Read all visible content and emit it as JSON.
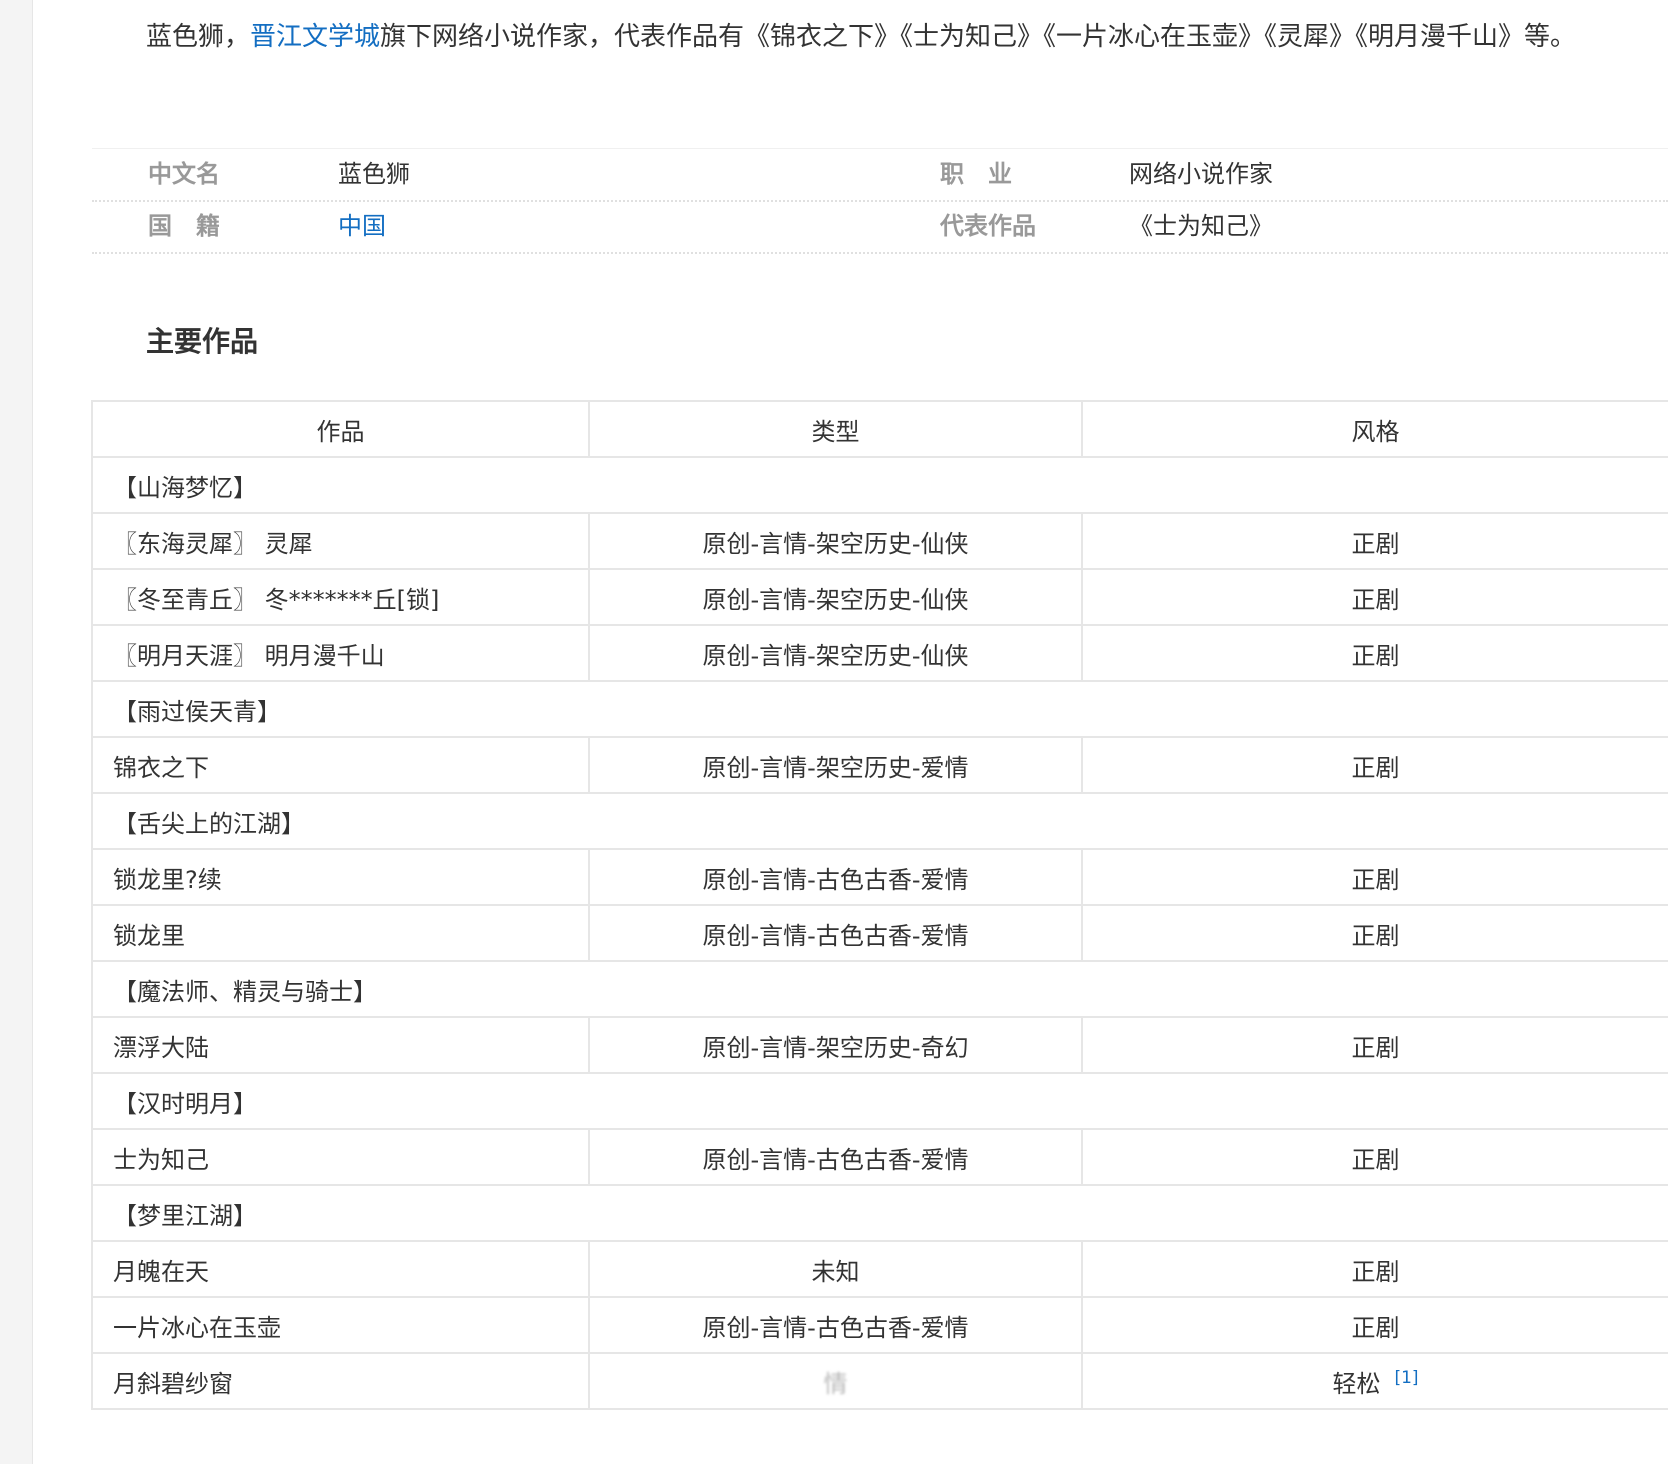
{
  "intro": {
    "prefix": "蓝色狮，",
    "link": "晋江文学城",
    "suffix": "旗下网络小说作家，代表作品有《锦衣之下》《士为知己》《一片冰心在玉壶》《灵犀》《明月漫千山》等。"
  },
  "basic_info": {
    "name_label": "中文名",
    "name_value": "蓝色狮",
    "job_label": "职业",
    "job_value": "网络小说作家",
    "country_label": "国籍",
    "country_value": "中国",
    "works_label": "代表作品",
    "works_value": "《士为知己》"
  },
  "section_title": "主要作品",
  "table": {
    "headers": [
      "作品",
      "类型",
      "风格"
    ],
    "rows": [
      {
        "group": "【山海梦忆】"
      },
      {
        "name": "〖东海灵犀〗 灵犀",
        "type": "原创-言情-架空历史-仙侠",
        "style": "正剧"
      },
      {
        "name": "〖冬至青丘〗 冬*******丘[锁]",
        "type": "原创-言情-架空历史-仙侠",
        "style": "正剧"
      },
      {
        "name": "〖明月天涯〗 明月漫千山",
        "type": "原创-言情-架空历史-仙侠",
        "style": "正剧"
      },
      {
        "group": "【雨过侯天青】"
      },
      {
        "name": "锦衣之下",
        "type": "原创-言情-架空历史-爱情",
        "style": "正剧"
      },
      {
        "group": "【舌尖上的江湖】"
      },
      {
        "name": "锁龙里?续",
        "type": "原创-言情-古色古香-爱情",
        "style": "正剧"
      },
      {
        "name": "锁龙里",
        "type": "原创-言情-古色古香-爱情",
        "style": "正剧"
      },
      {
        "group": "【魔法师、精灵与骑士】"
      },
      {
        "name": "漂浮大陆",
        "type": "原创-言情-架空历史-奇幻",
        "style": "正剧"
      },
      {
        "group": "【汉时明月】"
      },
      {
        "name": "士为知己",
        "type": "原创-言情-古色古香-爱情",
        "style": "正剧"
      },
      {
        "group": "【梦里江湖】"
      },
      {
        "name": "月魄在天",
        "type": "未知",
        "style": "正剧"
      },
      {
        "name": "一片冰心在玉壶",
        "type": "原创-言情-古色古香-爱情",
        "style": "正剧"
      },
      {
        "name": "月斜碧纱窗",
        "type": "情",
        "style": "轻松",
        "ref": "[1]"
      }
    ]
  },
  "colors": {
    "link": "#136ec2",
    "label": "#999999",
    "border": "#e6e6e6"
  }
}
